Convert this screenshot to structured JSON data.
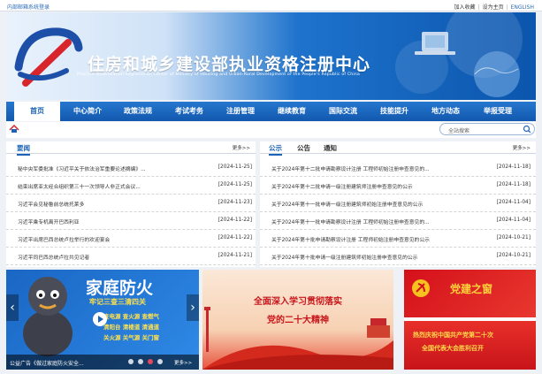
{
  "topbar": {
    "system_link": "内部邮箱系统登录",
    "favorite": "加入收藏",
    "homepage": "设为主页",
    "english": "ENGLISH"
  },
  "banner": {
    "title": "住房和城乡建设部执业资格注册中心",
    "subtitle": "Practice Qualification Registration Center of Ministry of Housing and Urban-Rural Development of the People's Republic of China"
  },
  "nav": [
    "首页",
    "中心简介",
    "政策法规",
    "考试考务",
    "注册管理",
    "继续教育",
    "国际交流",
    "技能提升",
    "地方动态",
    "举报受理"
  ],
  "search": {
    "placeholder": "全站搜索"
  },
  "left_panel": {
    "tab": "要闻",
    "more": "更多>>",
    "items": [
      {
        "title": "秘中央军委批准《习近平关于依法治军重要论述摘编》...",
        "date": "[2024-11-25]"
      },
      {
        "title": "结束出席亚太经合组织第三十一次领导人非正式会议...",
        "date": "[2024-11-25]"
      },
      {
        "title": "习近平会见秘鲁前总统托莱多",
        "date": "[2024-11-23]"
      },
      {
        "title": "习近平乘专机离开巴西利亚",
        "date": "[2024-11-22]"
      },
      {
        "title": "习近平出席巴西总统卢拉举行的欢迎宴会",
        "date": "[2024-11-22]"
      },
      {
        "title": "习近平同巴西总统卢拉共见记者",
        "date": "[2024-11-21]"
      }
    ]
  },
  "right_panel": {
    "tabs": [
      "公示",
      "公告",
      "通知"
    ],
    "more": "更多>>",
    "items": [
      {
        "title": "关于2024年第十二批申请勘察设计注册 工程师初始注册申查意见的...",
        "date": "[2024-11-18]"
      },
      {
        "title": "关于2024年第十二批申请一级注册建筑师注册申查意见的公示",
        "date": "[2024-11-18]"
      },
      {
        "title": "关于2024年第十一批申请一级注册建筑师初始注册申查意见的公示",
        "date": "[2024-11-04]"
      },
      {
        "title": "关于2024年第十一批申请勘察设计注册 工程师初始注册申查意见的...",
        "date": "[2024-11-04]"
      },
      {
        "title": "关于2024年第十批申请勘察设计注册 工程师初始注册申查意见的公示",
        "date": "[2024-10-21]"
      },
      {
        "title": "关于2024年第十批申请一级注册建筑师初始注册申查意见的公示",
        "date": "[2024-10-21]"
      }
    ]
  },
  "tiles": {
    "fire": {
      "headline": "家庭防火",
      "slogan": "牢记三查三清四关",
      "items": [
        "查电源 查火源 查燃气",
        "清阳台 清楼道 清通道",
        "关火源 关气源 关门窗"
      ],
      "caption": "公益广告《做过家庭防火安全...",
      "more": "更多>>"
    },
    "study": {
      "line1": "全面深入学习贯彻落实",
      "line2": "党的二十大精神"
    },
    "party": {
      "heading": "党建之窗",
      "line1": "热烈庆祝中国共产党第二十次",
      "line2": "全国代表大会胜利召开"
    }
  },
  "colors": {
    "primary": "#1c62b6",
    "nav_bg": "#1a66c0",
    "party_red": "#d4101a"
  }
}
